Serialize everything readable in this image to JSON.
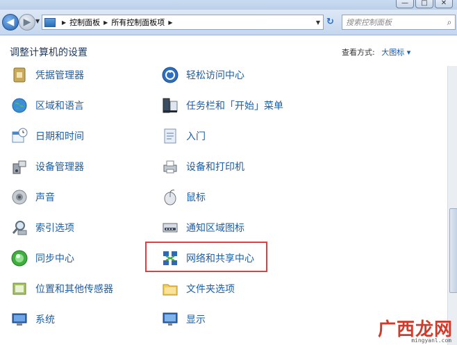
{
  "window": {
    "buttons": [
      "—",
      "□",
      "✕"
    ]
  },
  "toolbar": {
    "breadcrumb": [
      "控制面板",
      "所有控制面板项"
    ],
    "search_placeholder": "搜索控制面板"
  },
  "header": {
    "title": "调整计算机的设置",
    "view_label": "查看方式:",
    "view_value": "大图标 ▾"
  },
  "items_col1": [
    {
      "label": "凭据管理器",
      "icon": "credential-manager-icon"
    },
    {
      "label": "区域和语言",
      "icon": "globe-icon"
    },
    {
      "label": "日期和时间",
      "icon": "calendar-clock-icon"
    },
    {
      "label": "设备管理器",
      "icon": "device-manager-icon"
    },
    {
      "label": "声音",
      "icon": "speaker-icon"
    },
    {
      "label": "索引选项",
      "icon": "magnifier-icon"
    },
    {
      "label": "同步中心",
      "icon": "sync-icon"
    },
    {
      "label": "位置和其他传感器",
      "icon": "sensor-icon"
    },
    {
      "label": "系统",
      "icon": "computer-icon"
    }
  ],
  "items_col2": [
    {
      "label": "轻松访问中心",
      "icon": "ease-of-access-icon"
    },
    {
      "label": "任务栏和「开始」菜单",
      "icon": "taskbar-icon"
    },
    {
      "label": "入门",
      "icon": "getting-started-icon"
    },
    {
      "label": "设备和打印机",
      "icon": "printer-icon"
    },
    {
      "label": "鼠标",
      "icon": "mouse-icon"
    },
    {
      "label": "通知区域图标",
      "icon": "notification-area-icon"
    },
    {
      "label": "网络和共享中心",
      "icon": "network-icon"
    },
    {
      "label": "文件夹选项",
      "icon": "folder-options-icon"
    },
    {
      "label": "显示",
      "icon": "monitor-icon"
    }
  ],
  "watermark": {
    "text": "广西龙网",
    "url": "mingyanl.com"
  }
}
